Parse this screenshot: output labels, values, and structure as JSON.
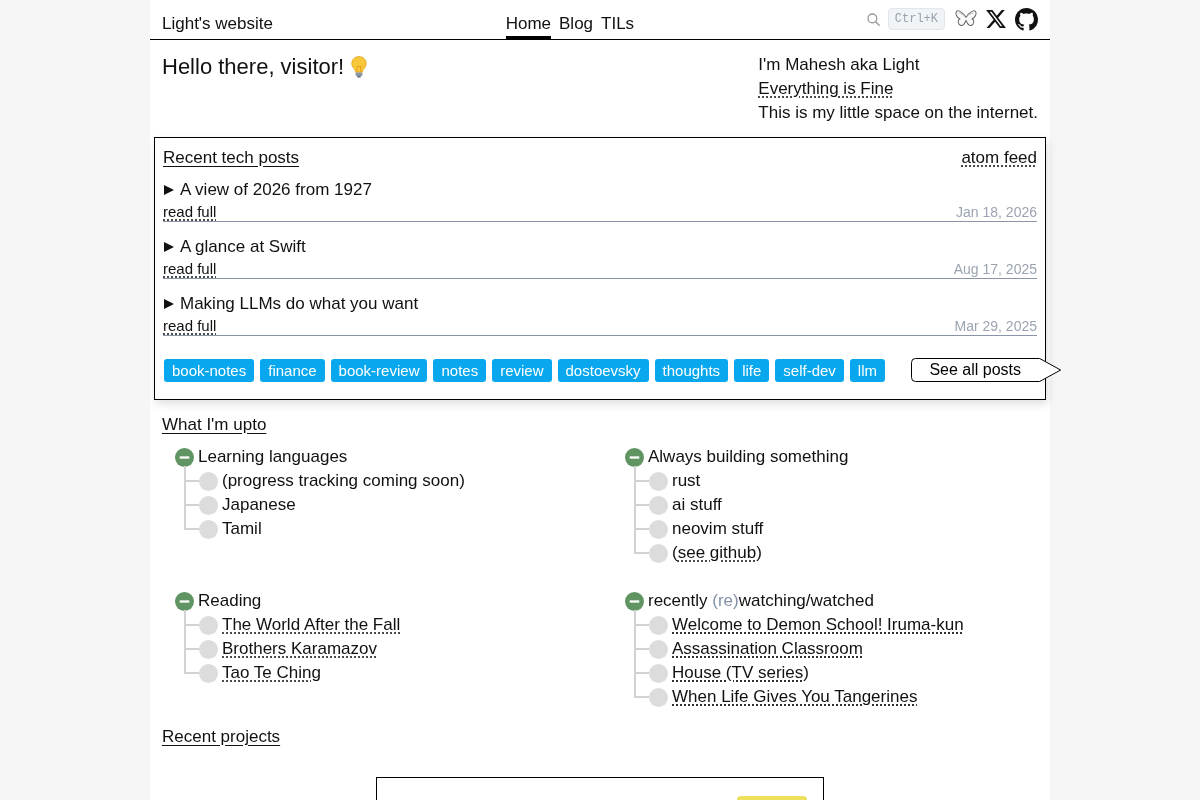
{
  "header": {
    "site_title": "Light's website",
    "nav": [
      {
        "label": "Home",
        "selected": true
      },
      {
        "label": "Blog",
        "selected": false
      },
      {
        "label": "TILs",
        "selected": false
      }
    ],
    "search_shortcut": "Ctrl+K"
  },
  "intro": {
    "greeting": "Hello there, visitor!",
    "about": [
      {
        "kind": "text",
        "text": "I'm Mahesh aka Light"
      },
      {
        "kind": "link",
        "text": "Everything is Fine"
      },
      {
        "kind": "text",
        "text": "This is my little space on the internet."
      }
    ]
  },
  "recent_posts": {
    "title": "Recent tech posts",
    "feed_link": "atom feed",
    "posts": [
      {
        "title": "A view of 2026 from 1927",
        "expanded": false,
        "read_link": "read full",
        "date": "Jan 18, 2026"
      },
      {
        "title": "A glance at Swift",
        "expanded": false,
        "read_link": "read full",
        "date": "Aug 17, 2025"
      },
      {
        "title": "Making LLMs do what you want",
        "expanded": false,
        "read_link": "read full",
        "date": "Mar 29, 2025"
      }
    ],
    "tags": [
      "book-notes",
      "finance",
      "book-review",
      "notes",
      "review",
      "dostoevsky",
      "thoughts",
      "life",
      "self-dev",
      "llm"
    ],
    "see_all": "See all posts"
  },
  "upto": {
    "title": "What I'm upto",
    "groups": [
      {
        "label": [
          {
            "kind": "plain",
            "text": "Learning languages"
          }
        ],
        "expanded": true,
        "children": [
          {
            "kind": "text",
            "text": "(progress tracking coming soon)"
          },
          {
            "kind": "text",
            "text": "Japanese"
          },
          {
            "kind": "text",
            "text": "Tamil"
          }
        ]
      },
      {
        "label": [
          {
            "kind": "plain",
            "text": "Always building something"
          }
        ],
        "expanded": true,
        "children": [
          {
            "kind": "text",
            "text": "rust"
          },
          {
            "kind": "text",
            "text": "ai stuff"
          },
          {
            "kind": "text",
            "text": "neovim stuff"
          },
          {
            "kind": "link",
            "before": "(",
            "text": "see github",
            "after": ")"
          }
        ]
      },
      {
        "label": [
          {
            "kind": "plain",
            "text": "Reading"
          }
        ],
        "expanded": true,
        "children": [
          {
            "kind": "link",
            "text": "The World After the Fall"
          },
          {
            "kind": "link",
            "text": "Brothers Karamazov"
          },
          {
            "kind": "link",
            "text": "Tao Te Ching"
          }
        ]
      },
      {
        "label": [
          {
            "kind": "plain",
            "text": "recently "
          },
          {
            "kind": "muted",
            "text": "(re)"
          },
          {
            "kind": "plain",
            "text": "watching/watched"
          }
        ],
        "expanded": true,
        "children": [
          {
            "kind": "link",
            "text": "Welcome to Demon School! Iruma-kun"
          },
          {
            "kind": "link",
            "text": "Assassination Classroom"
          },
          {
            "kind": "link",
            "text": "House (TV series)"
          },
          {
            "kind": "link",
            "text": "When Life Gives You Tangerines"
          }
        ]
      }
    ]
  },
  "recent_projects": {
    "title": "Recent projects",
    "projects": [
      {
        "color": "#eee05c"
      }
    ]
  }
}
